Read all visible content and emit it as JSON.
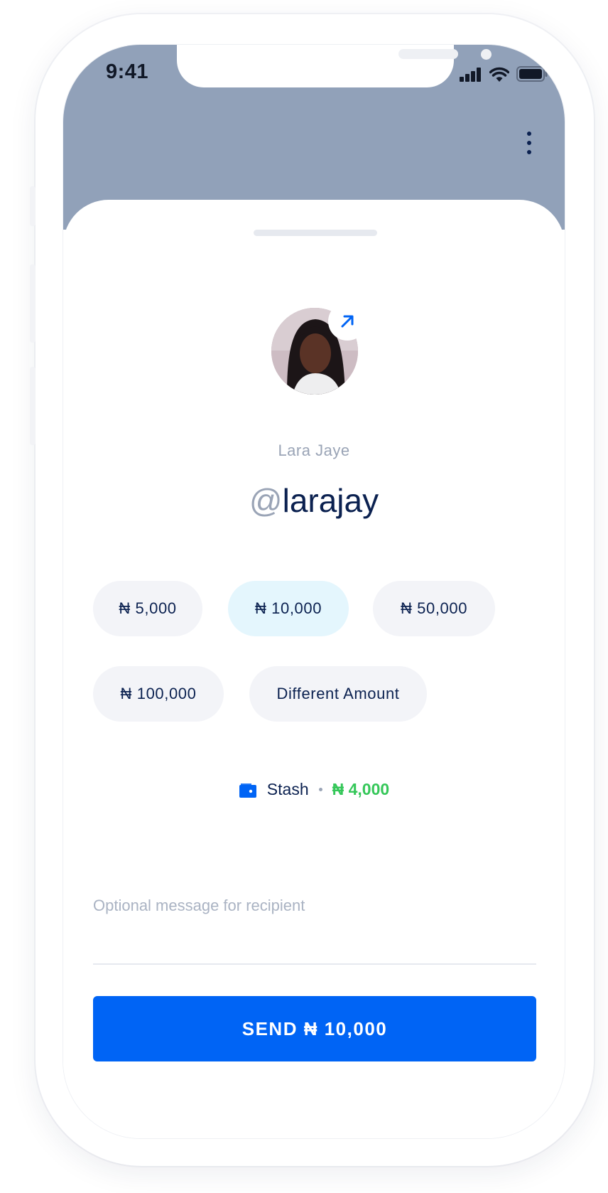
{
  "status_bar": {
    "time": "9:41"
  },
  "recipient": {
    "name": "Lara Jaye",
    "handle_prefix": "@",
    "handle": "larajay"
  },
  "amount_options": [
    {
      "label": "₦ 5,000",
      "selected": false
    },
    {
      "label": "₦ 10,000",
      "selected": true
    },
    {
      "label": "₦ 50,000",
      "selected": false
    },
    {
      "label": "₦ 100,000",
      "selected": false
    },
    {
      "label": "Different Amount",
      "selected": false
    }
  ],
  "source": {
    "label": "Stash",
    "balance": "₦ 4,000"
  },
  "message": {
    "placeholder": "Optional message for recipient",
    "value": ""
  },
  "send_button": {
    "label": "SEND ₦ 10,000"
  },
  "colors": {
    "header": "#91a1b9",
    "primary": "#0064f5",
    "text_dark": "#0b2150",
    "text_muted": "#9aa4b6",
    "chip": "#f3f4f8",
    "chip_selected": "#e4f6fd",
    "success": "#35c759"
  },
  "icons": [
    "more-vertical-icon",
    "arrow-up-right-icon",
    "wallet-icon",
    "signal-icon",
    "wifi-icon",
    "battery-icon"
  ]
}
